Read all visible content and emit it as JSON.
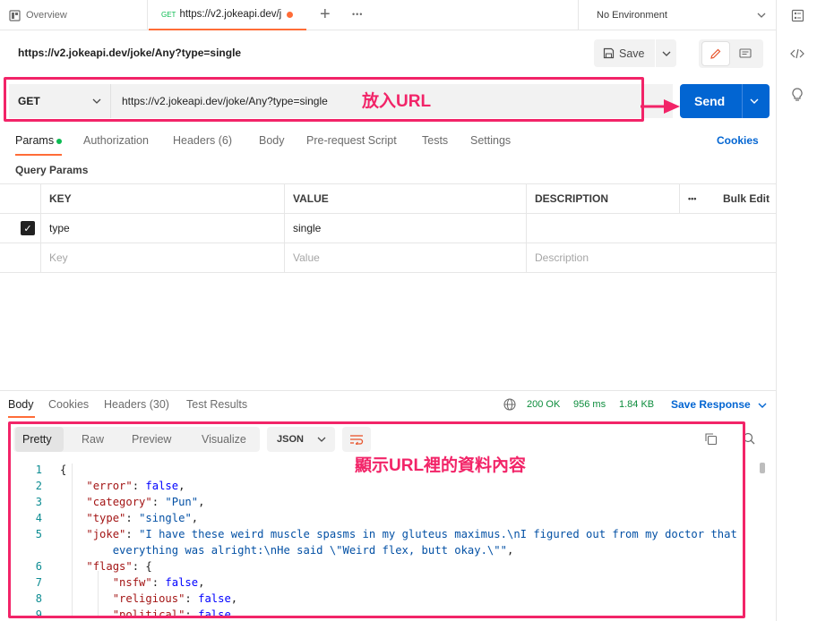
{
  "tabs": {
    "overview_label": "Overview",
    "request_method": "GET",
    "request_label": "https://v2.jokeapi.dev/j",
    "plus": "+",
    "more": "•••"
  },
  "environment": {
    "label": "No Environment"
  },
  "request": {
    "title": "https://v2.jokeapi.dev/joke/Any?type=single",
    "save_label": "Save",
    "method": "GET",
    "url": "https://v2.jokeapi.dev/joke/Any?type=single",
    "send_label": "Send"
  },
  "annotations": {
    "url_note": "放入URL",
    "response_note": "顯示URL裡的資料內容"
  },
  "request_tabs": {
    "params": "Params",
    "authorization": "Authorization",
    "headers": "Headers (6)",
    "body": "Body",
    "pre_request": "Pre-request Script",
    "tests": "Tests",
    "settings": "Settings",
    "cookies": "Cookies"
  },
  "query_params": {
    "title": "Query Params",
    "headers": {
      "key": "KEY",
      "value": "VALUE",
      "description": "DESCRIPTION",
      "more": "•••",
      "bulk_edit": "Bulk Edit"
    },
    "rows": [
      {
        "key": "type",
        "value": "single",
        "description": "",
        "checked": true
      }
    ],
    "placeholders": {
      "key": "Key",
      "value": "Value",
      "description": "Description"
    }
  },
  "response_tabs": {
    "body": "Body",
    "cookies": "Cookies",
    "headers": "Headers (30)",
    "test_results": "Test Results",
    "status": "200 OK",
    "time": "956 ms",
    "size": "1.84 KB",
    "save_response": "Save Response"
  },
  "response_view": {
    "pretty": "Pretty",
    "raw": "Raw",
    "preview": "Preview",
    "visualize": "Visualize",
    "format": "JSON"
  },
  "code_lines": [
    {
      "n": "1",
      "text": "{"
    },
    {
      "n": "2",
      "key": "\"error\"",
      "val": "false",
      "vtype": "b",
      "tail": ",",
      "indent": "    "
    },
    {
      "n": "3",
      "key": "\"category\"",
      "val": "\"Pun\"",
      "vtype": "s",
      "tail": ",",
      "indent": "    "
    },
    {
      "n": "4",
      "key": "\"type\"",
      "val": "\"single\"",
      "vtype": "s",
      "tail": ",",
      "indent": "    "
    },
    {
      "n": "5",
      "key": "\"joke\"",
      "val": "\"I have these weird muscle spasms in my gluteus maximus.\\nI figured out from my doctor that",
      "vtype": "s",
      "tail": "",
      "indent": "    "
    },
    {
      "n": "",
      "cont": "        everything was alright:\\nHe said \\\"Weird flex, butt okay.\\\"\"",
      "tail": ","
    },
    {
      "n": "6",
      "key": "\"flags\"",
      "val": "{",
      "vtype": "p",
      "tail": "",
      "indent": "    "
    },
    {
      "n": "7",
      "key": "\"nsfw\"",
      "val": "false",
      "vtype": "b",
      "tail": ",",
      "indent": "        "
    },
    {
      "n": "8",
      "key": "\"religious\"",
      "val": "false",
      "vtype": "b",
      "tail": ",",
      "indent": "        "
    },
    {
      "n": "9",
      "key": "\"political\"",
      "val": "false",
      "vtype": "b",
      "tail": ",",
      "indent": "        "
    }
  ],
  "colors": {
    "accent": "#ff6c37",
    "send_blue": "#0265d2",
    "annotation_pink": "#f22468",
    "status_green": "#0c8c3c"
  }
}
